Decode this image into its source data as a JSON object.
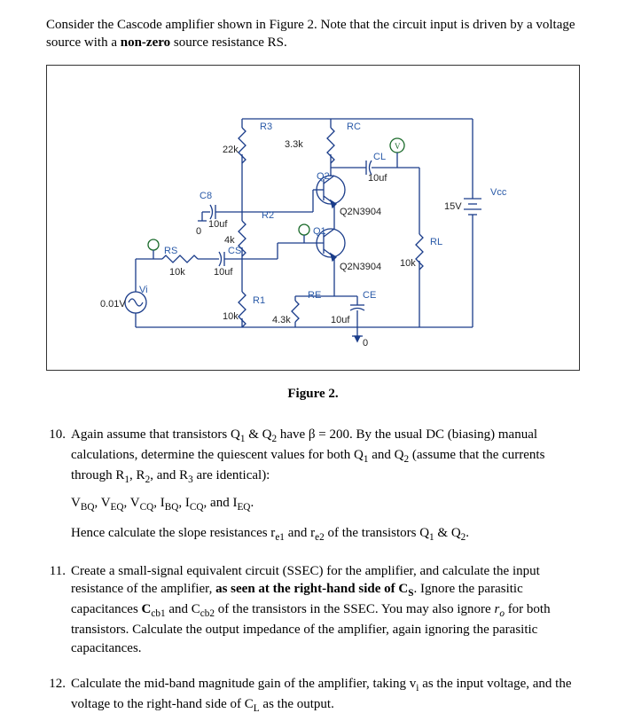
{
  "intro": {
    "p1a": "Consider the Cascode amplifier shown in Figure 2.  Note that the circuit input is driven by a voltage source with a ",
    "p1b": "non-zero",
    "p1c": " source resistance RS."
  },
  "figure": {
    "caption": "Figure 2.",
    "labels": {
      "R3": "R3",
      "R3v": "22k",
      "RC": "RC",
      "RCv": "3.3k",
      "CL": "CL",
      "CLv": "10uf",
      "C8": "C8",
      "C8v": "10uf",
      "R2": "R2",
      "R2v": "4k",
      "Q2": "Q2",
      "Q2m": "Q2N3904",
      "Q1": "Q1",
      "Q1m": "Q2N3904",
      "Vcc": "Vcc",
      "Vccv": "15V",
      "RS": "RS",
      "RSv": "10k",
      "CS": "CS",
      "CSv": "10uf",
      "RL": "RL",
      "RLv": "10k",
      "R1": "R1",
      "R1v": "10k",
      "RE": "RE",
      "REv": "4.3k",
      "CE": "CE",
      "CEv": "10uf",
      "Vi": "Vi",
      "Viv": "0.01V",
      "gnd1": "0",
      "gnd2": "0"
    }
  },
  "questions": {
    "q10": {
      "num": "10.",
      "p1a": "Again assume that transistors Q",
      "p1b": " & Q",
      "p1c": "  have β = 200. By the usual DC (biasing) manual calculations, determine the quiescent values for both Q",
      "p1d": " and Q",
      "p1e": " (assume that the currents through R",
      "p1f": ", R",
      "p1g": ", and R",
      "p1h": " are identical):",
      "vals": "V",
      "vals_rest": ", V",
      "vals_3": ", V",
      "vals_4": ", I",
      "vals_5": ", I",
      "vals_6": ", and I",
      "vals_end": ".",
      "sub_BQ": "BQ",
      "sub_EQ": "EQ",
      "sub_CQ": "CQ",
      "sub_IBQ": "BQ",
      "sub_ICQ": "CQ",
      "sub_IEQ": "EQ",
      "p3a": "Hence calculate the slope resistances r",
      "p3b": " and r",
      "p3c": " of the transistors Q",
      "p3d": " & Q",
      "p3e": ".",
      "sub_e1": "e1",
      "sub_e2": "e2"
    },
    "q11": {
      "num": "11.",
      "p1a": "Create a small-signal equivalent circuit (SSEC) for the amplifier, and calculate the input resistance of the amplifier, ",
      "p1b": "as seen at the right-hand side of C",
      "p1b_sub": "S",
      "p1c": ". Ignore the parasitic capacitances",
      "p1d": " C",
      "p1d_sub1": "cb1",
      "p1e": " and C",
      "p1e_sub": "cb2",
      "p1f": " of the transistors in the SSEC.  You may also ignore ",
      "p1g": "r",
      "p1g_sub": "o",
      "p1h": " for both transistors.  Calculate the output impedance of the amplifier, again ignoring the parasitic capacitances."
    },
    "q12": {
      "num": "12.",
      "p1a": "Calculate the mid-band magnitude gain of the amplifier, taking v",
      "p1a_sub": "i",
      "p1b": " as the input voltage, and the voltage to the right-hand side of C",
      "p1b_sub": "L",
      "p1c": " as the output."
    }
  }
}
